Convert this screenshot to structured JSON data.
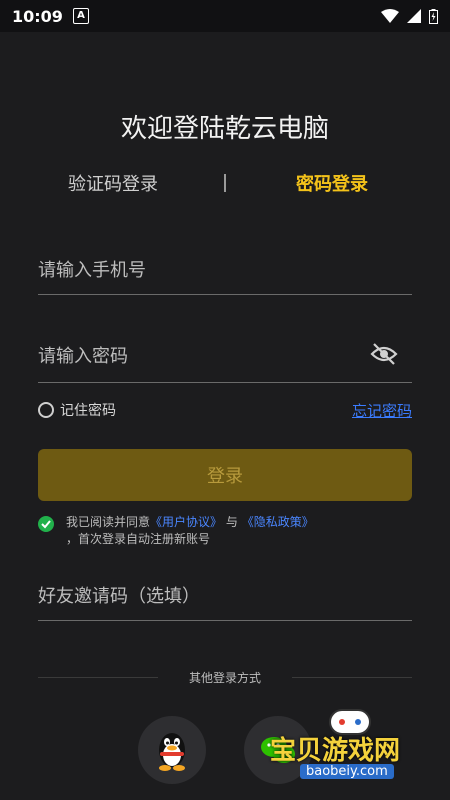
{
  "status_bar": {
    "time": "10:09",
    "notification_badge": "A"
  },
  "title": "欢迎登陆乾云电脑",
  "tabs": {
    "sms_login": "验证码登录",
    "password_login": "密码登录"
  },
  "form": {
    "phone_placeholder": "请输入手机号",
    "password_placeholder": "请输入密码",
    "remember_label": "记住密码",
    "forgot_label": "忘记密码",
    "login_label": "登录",
    "agreement": {
      "prefix": "我已阅读并同意",
      "user_agreement": "《用户协议》",
      "and": "与",
      "privacy_policy": "《隐私政策》",
      "suffix": "，首次登录自动注册新账号"
    },
    "invite_placeholder": "好友邀请码（选填）"
  },
  "other_login": {
    "label": "其他登录方式"
  },
  "watermark": {
    "text": "宝贝游戏网",
    "url": "baobeiy.com"
  },
  "colors": {
    "accent": "#f3c21a",
    "link": "#3b7cff",
    "button_bg": "#6e5a12",
    "background": "#1c1c1e"
  }
}
